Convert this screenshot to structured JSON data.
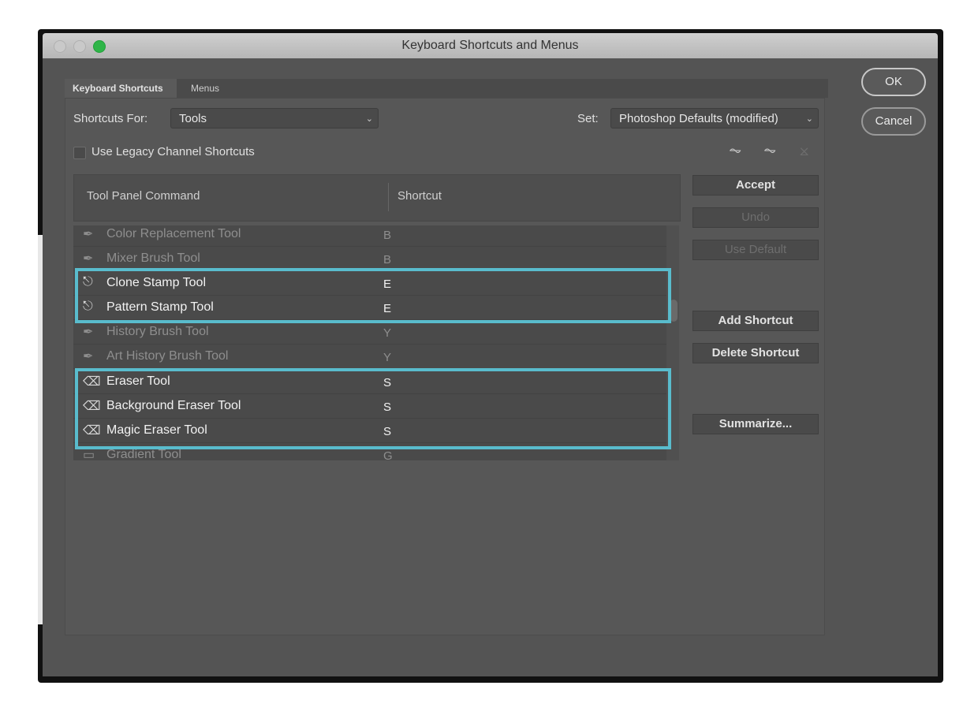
{
  "window": {
    "title": "Keyboard Shortcuts and Menus"
  },
  "tabs": [
    {
      "label": "Keyboard Shortcuts",
      "active": true
    },
    {
      "label": "Menus",
      "active": false
    }
  ],
  "shortcuts_for": {
    "label": "Shortcuts For:",
    "value": "Tools"
  },
  "set": {
    "label": "Set:",
    "value": "Photoshop Defaults (modified)"
  },
  "legacy_channel": {
    "label": "Use Legacy Channel Shortcuts",
    "checked": false
  },
  "set_icons": [
    "save-set-icon",
    "new-set-icon",
    "delete-set-icon"
  ],
  "table": {
    "headers": {
      "command": "Tool Panel Command",
      "shortcut": "Shortcut"
    },
    "rows": [
      {
        "name": "Color Replacement Tool",
        "shortcut": "B",
        "icon": "color-replacement-icon",
        "highlighted": false
      },
      {
        "name": "Mixer Brush Tool",
        "shortcut": "B",
        "icon": "mixer-brush-icon",
        "highlighted": false
      },
      {
        "name": "Clone Stamp Tool",
        "shortcut": "E",
        "icon": "clone-stamp-icon",
        "highlighted": true
      },
      {
        "name": "Pattern Stamp Tool",
        "shortcut": "E",
        "icon": "pattern-stamp-icon",
        "highlighted": true
      },
      {
        "name": "History Brush Tool",
        "shortcut": "Y",
        "icon": "history-brush-icon",
        "highlighted": false
      },
      {
        "name": "Art History Brush Tool",
        "shortcut": "Y",
        "icon": "art-history-brush-icon",
        "highlighted": false
      },
      {
        "name": "Eraser Tool",
        "shortcut": "S",
        "icon": "eraser-icon",
        "highlighted": true
      },
      {
        "name": "Background Eraser Tool",
        "shortcut": "S",
        "icon": "background-eraser-icon",
        "highlighted": true
      },
      {
        "name": "Magic Eraser Tool",
        "shortcut": "S",
        "icon": "magic-eraser-icon",
        "highlighted": true
      },
      {
        "name": "Gradient Tool",
        "shortcut": "G",
        "icon": "gradient-icon",
        "highlighted": false
      }
    ]
  },
  "side_buttons": {
    "accept": "Accept",
    "undo": "Undo",
    "use_default": "Use Default",
    "add_shortcut": "Add Shortcut",
    "delete_shortcut": "Delete Shortcut",
    "summarize": "Summarize..."
  },
  "dialog_buttons": {
    "ok": "OK",
    "cancel": "Cancel"
  },
  "colors": {
    "highlight": "#59bccd",
    "zoom_button": "#2fb548",
    "panel": "#545454"
  }
}
